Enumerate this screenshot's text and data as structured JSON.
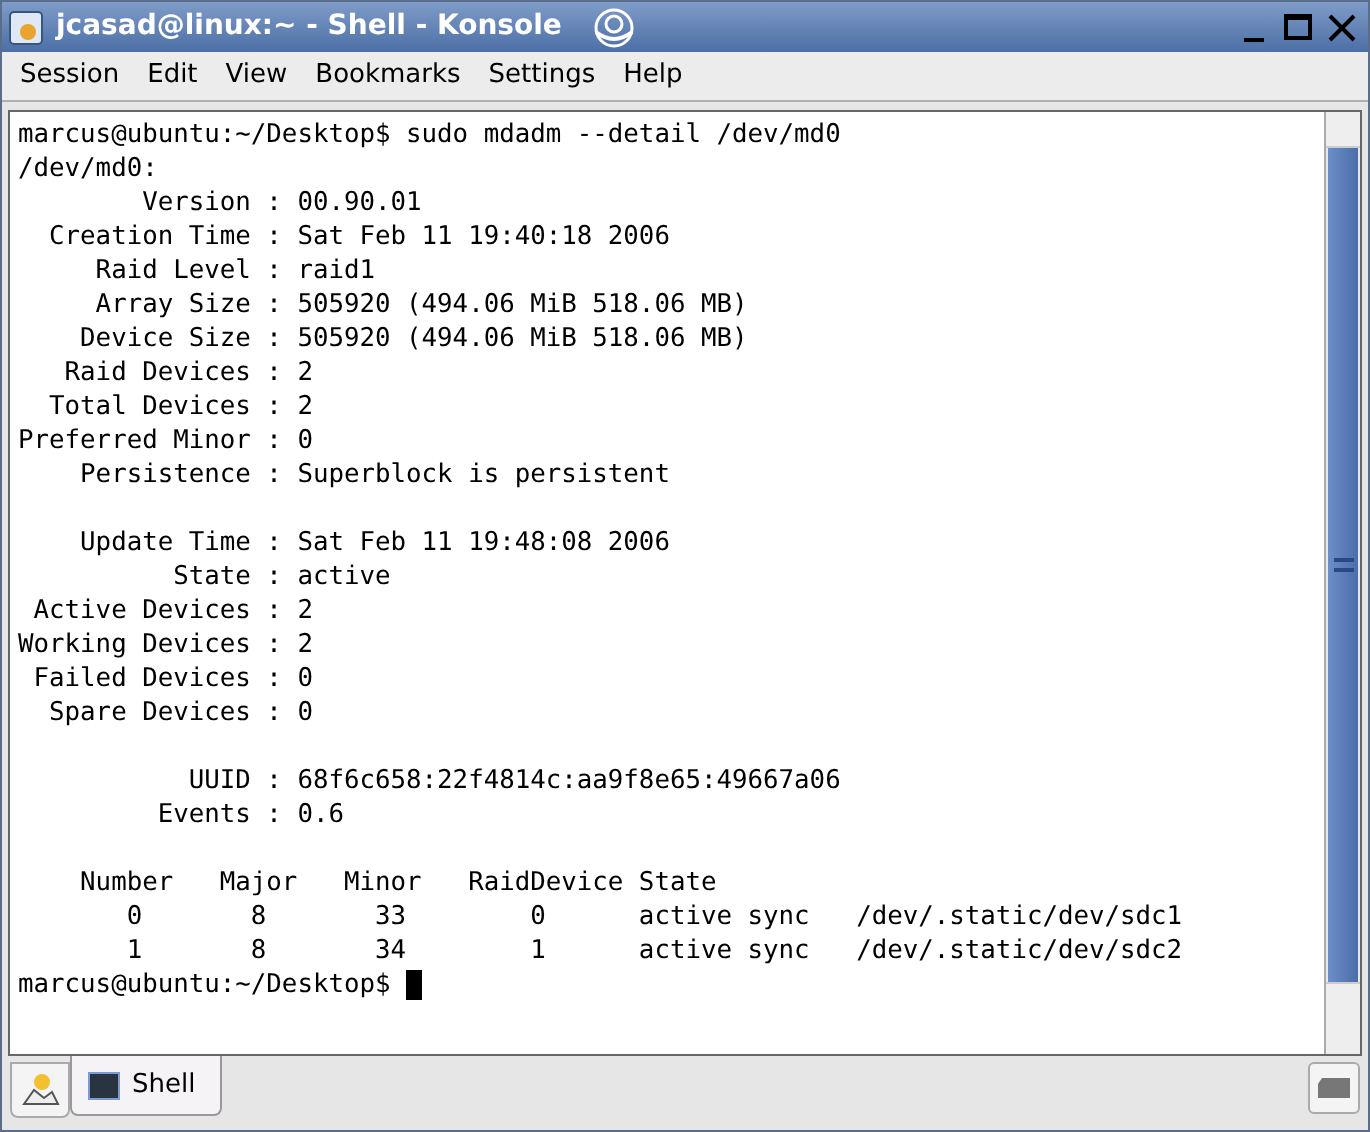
{
  "window": {
    "title": "jcasad@linux:~ - Shell - Konsole"
  },
  "menu": [
    "Session",
    "Edit",
    "View",
    "Bookmarks",
    "Settings",
    "Help"
  ],
  "terminal": {
    "blocks": [
      [
        "marcus@ubuntu:~/Desktop$ sudo mdadm --detail /dev/md0",
        "/dev/md0:",
        "        Version : 00.90.01",
        "  Creation Time : Sat Feb 11 19:40:18 2006",
        "     Raid Level : raid1",
        "     Array Size : 505920 (494.06 MiB 518.06 MB)",
        "    Device Size : 505920 (494.06 MiB 518.06 MB)",
        "   Raid Devices : 2",
        "  Total Devices : 2",
        "Preferred Minor : 0",
        "    Persistence : Superblock is persistent"
      ],
      [
        "    Update Time : Sat Feb 11 19:48:08 2006",
        "          State : active",
        " Active Devices : 2",
        "Working Devices : 2",
        " Failed Devices : 0",
        "  Spare Devices : 0"
      ],
      [
        "           UUID : 68f6c658:22f4814c:aa9f8e65:49667a06",
        "         Events : 0.6"
      ],
      [
        "    Number   Major   Minor   RaidDevice State",
        "       0       8       33        0      active sync   /dev/.static/dev/sdc1",
        "       1       8       34        1      active sync   /dev/.static/dev/sdc2"
      ]
    ],
    "prompt": "marcus@ubuntu:~/Desktop$ "
  },
  "tabs": [
    {
      "label": "Shell",
      "selected": true
    }
  ]
}
